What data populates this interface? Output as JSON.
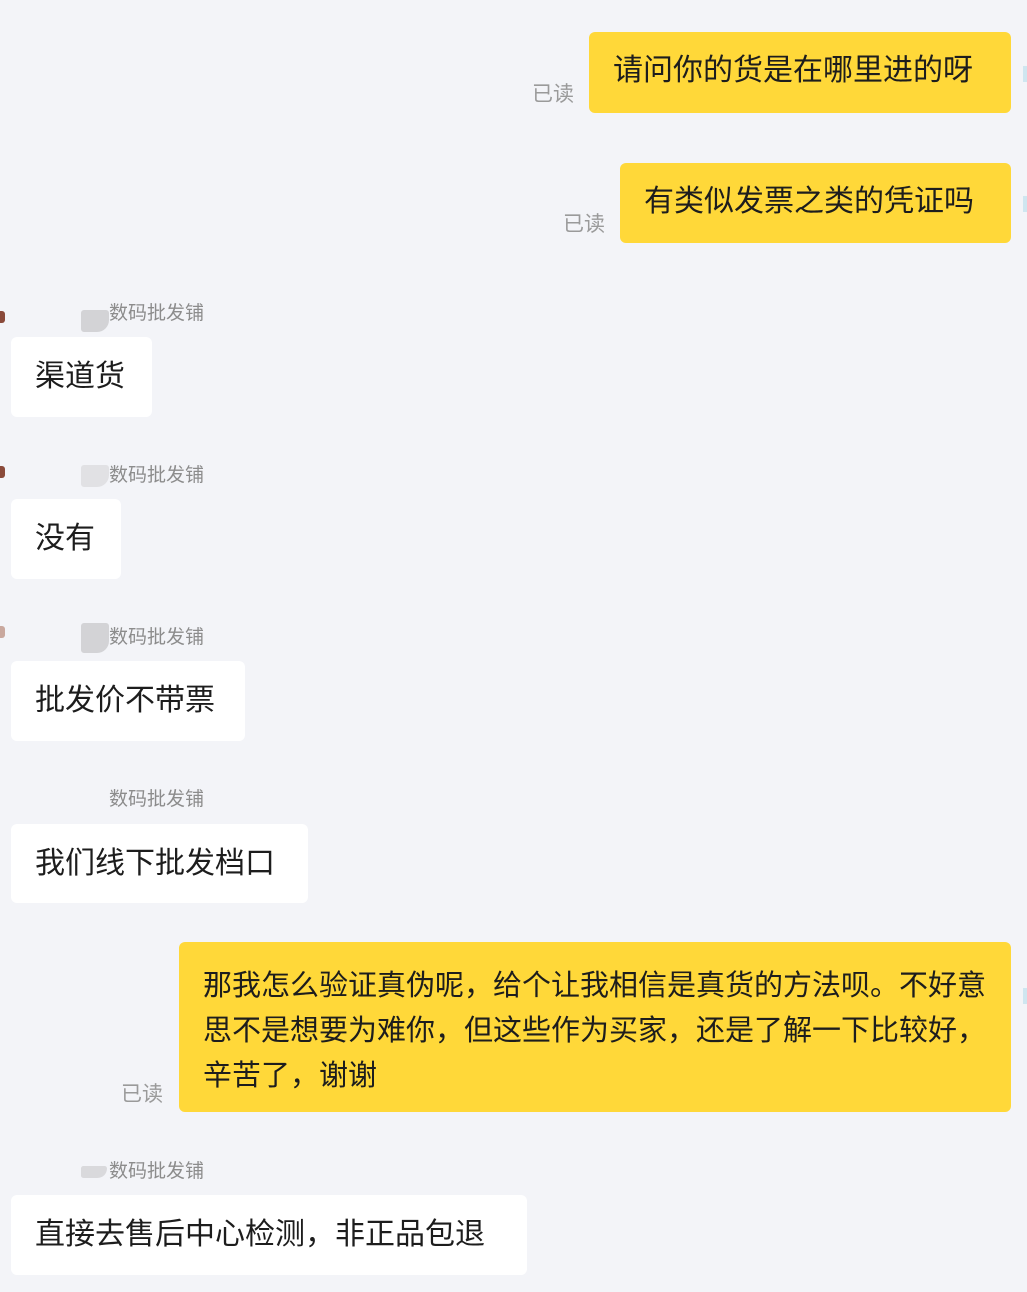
{
  "read_label": "已读",
  "shop_name": "数码批发铺",
  "messages": [
    {
      "direction": "out",
      "text": "请问你的货是在哪里进的呀"
    },
    {
      "direction": "out",
      "text": "有类似发票之类的凭证吗"
    },
    {
      "direction": "in",
      "text": "渠道货"
    },
    {
      "direction": "in",
      "text": "没有"
    },
    {
      "direction": "in",
      "text": "批发价不带票"
    },
    {
      "direction": "in",
      "text": "我们线下批发档口"
    },
    {
      "direction": "out",
      "text": "那我怎么验证真伪呢，给个让我相信是真货的方法呗。不好意思不是想要为难你，但这些作为买家，还是了解一下比较好，辛苦了，谢谢"
    },
    {
      "direction": "in",
      "text": "直接去售后中心检测，非正品包退"
    }
  ]
}
